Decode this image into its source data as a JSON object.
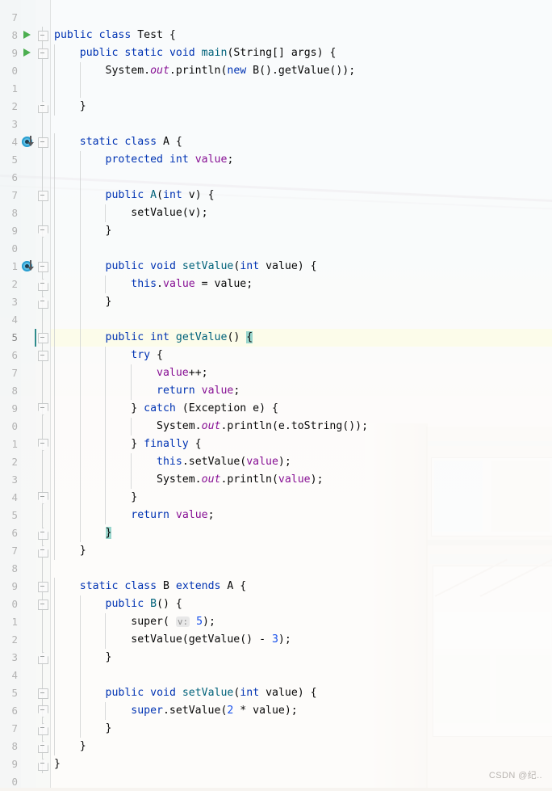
{
  "editor": {
    "language": "Java",
    "file_name": "Test.java",
    "caret_line": 45,
    "theme": "IntelliJ Light",
    "colors": {
      "keyword": "#0033b3",
      "method": "#00627a",
      "field": "#871094",
      "static_field": "#871094",
      "number": "#1750eb",
      "text": "#080808",
      "line_number": "#b3b3b3",
      "caret_line_bg": "#fbfbe0",
      "brace_match_bg": "#99d6cc",
      "run_marker": "#4caf50",
      "override_marker": "#5fc0e8",
      "overriding_arrow": "#e2554f"
    },
    "gutter": {
      "line_numbers": [
        "7",
        "8",
        "9",
        "0",
        "1",
        "2",
        "3",
        "4",
        "5",
        "6",
        "7",
        "8",
        "9",
        "0",
        "1",
        "2",
        "3",
        "4",
        "5",
        "6",
        "7",
        "8",
        "9",
        "0",
        "1",
        "2",
        "3",
        "4",
        "5",
        "6",
        "7",
        "8",
        "9",
        "0",
        "1",
        "2",
        "3",
        "4",
        "5",
        "6",
        "7",
        "8",
        "9",
        "0"
      ],
      "full_line_numbers": [
        7,
        8,
        9,
        10,
        11,
        12,
        13,
        14,
        15,
        16,
        17,
        18,
        19,
        20,
        21,
        22,
        23,
        24,
        25,
        26,
        27,
        28,
        29,
        30,
        31,
        32,
        33,
        34,
        35,
        36,
        37,
        38,
        39,
        40,
        41,
        42,
        43,
        44,
        45,
        46,
        47,
        48,
        49,
        50
      ],
      "markers": [
        {
          "line": 8,
          "type": "run-gutter-icon",
          "label": "Run Test.main()"
        },
        {
          "line": 9,
          "type": "run-gutter-icon",
          "label": "Run main()"
        },
        {
          "line": 14,
          "type": "overridden-method-icon",
          "label": "Method is overridden"
        },
        {
          "line": 21,
          "type": "overridden-method-icon",
          "label": "Method is overridden"
        },
        {
          "line": 55,
          "type": "overriding-method-icon",
          "label": "Overrides method in A"
        }
      ]
    },
    "lines": [
      {
        "n": "7",
        "indent": 0,
        "segments": []
      },
      {
        "n": "8",
        "indent": 0,
        "segments": [
          {
            "t": "public",
            "c": "kw"
          },
          {
            "t": " ",
            "c": ""
          },
          {
            "t": "class",
            "c": "kw"
          },
          {
            "t": " Test {",
            "c": ""
          }
        ]
      },
      {
        "n": "9",
        "indent": 1,
        "segments": [
          {
            "t": "    ",
            "c": ""
          },
          {
            "t": "public",
            "c": "kw"
          },
          {
            "t": " ",
            "c": ""
          },
          {
            "t": "static",
            "c": "kw"
          },
          {
            "t": " ",
            "c": ""
          },
          {
            "t": "void",
            "c": "kw"
          },
          {
            "t": " ",
            "c": ""
          },
          {
            "t": "main",
            "c": "mth"
          },
          {
            "t": "(String[] args) {",
            "c": ""
          }
        ]
      },
      {
        "n": "0",
        "indent": 2,
        "segments": [
          {
            "t": "        System.",
            "c": ""
          },
          {
            "t": "out",
            "c": "stat"
          },
          {
            "t": ".println(",
            "c": ""
          },
          {
            "t": "new",
            "c": "kw"
          },
          {
            "t": " B().getValue());",
            "c": ""
          }
        ]
      },
      {
        "n": "1",
        "indent": 2,
        "segments": []
      },
      {
        "n": "2",
        "indent": 1,
        "segments": [
          {
            "t": "    }",
            "c": ""
          }
        ]
      },
      {
        "n": "3",
        "indent": 0,
        "segments": []
      },
      {
        "n": "4",
        "indent": 1,
        "segments": [
          {
            "t": "    ",
            "c": ""
          },
          {
            "t": "static",
            "c": "kw"
          },
          {
            "t": " ",
            "c": ""
          },
          {
            "t": "class",
            "c": "kw"
          },
          {
            "t": " A {",
            "c": ""
          }
        ]
      },
      {
        "n": "5",
        "indent": 2,
        "segments": [
          {
            "t": "        ",
            "c": ""
          },
          {
            "t": "protected",
            "c": "kw"
          },
          {
            "t": " ",
            "c": ""
          },
          {
            "t": "int",
            "c": "kw"
          },
          {
            "t": " ",
            "c": ""
          },
          {
            "t": "value",
            "c": "fld"
          },
          {
            "t": ";",
            "c": ""
          }
        ]
      },
      {
        "n": "6",
        "indent": 2,
        "segments": []
      },
      {
        "n": "7",
        "indent": 2,
        "segments": [
          {
            "t": "        ",
            "c": ""
          },
          {
            "t": "public",
            "c": "kw"
          },
          {
            "t": " ",
            "c": ""
          },
          {
            "t": "A",
            "c": "mth"
          },
          {
            "t": "(",
            "c": ""
          },
          {
            "t": "int",
            "c": "kw"
          },
          {
            "t": " v) {",
            "c": ""
          }
        ]
      },
      {
        "n": "8",
        "indent": 3,
        "segments": [
          {
            "t": "            setValue(v);",
            "c": ""
          }
        ]
      },
      {
        "n": "9",
        "indent": 2,
        "segments": [
          {
            "t": "        }",
            "c": ""
          }
        ]
      },
      {
        "n": "0",
        "indent": 2,
        "segments": []
      },
      {
        "n": "1",
        "indent": 2,
        "segments": [
          {
            "t": "        ",
            "c": ""
          },
          {
            "t": "public",
            "c": "kw"
          },
          {
            "t": " ",
            "c": ""
          },
          {
            "t": "void",
            "c": "kw"
          },
          {
            "t": " ",
            "c": ""
          },
          {
            "t": "setValue",
            "c": "mth"
          },
          {
            "t": "(",
            "c": ""
          },
          {
            "t": "int",
            "c": "kw"
          },
          {
            "t": " value) {",
            "c": ""
          }
        ]
      },
      {
        "n": "2",
        "indent": 3,
        "segments": [
          {
            "t": "            ",
            "c": ""
          },
          {
            "t": "this",
            "c": "kw"
          },
          {
            "t": ".",
            "c": ""
          },
          {
            "t": "value",
            "c": "fld"
          },
          {
            "t": " = value;",
            "c": ""
          }
        ]
      },
      {
        "n": "3",
        "indent": 2,
        "segments": [
          {
            "t": "        }",
            "c": ""
          }
        ]
      },
      {
        "n": "4",
        "indent": 2,
        "segments": []
      },
      {
        "n": "5",
        "indent": 2,
        "caret": true,
        "segments": [
          {
            "t": "        ",
            "c": ""
          },
          {
            "t": "public",
            "c": "kw"
          },
          {
            "t": " ",
            "c": ""
          },
          {
            "t": "int",
            "c": "kw"
          },
          {
            "t": " ",
            "c": ""
          },
          {
            "t": "getValue",
            "c": "mth"
          },
          {
            "t": "() ",
            "c": ""
          },
          {
            "t": "{",
            "c": "brace-hl"
          }
        ]
      },
      {
        "n": "6",
        "indent": 3,
        "segments": [
          {
            "t": "            ",
            "c": ""
          },
          {
            "t": "try",
            "c": "kw"
          },
          {
            "t": " {",
            "c": ""
          }
        ]
      },
      {
        "n": "7",
        "indent": 4,
        "segments": [
          {
            "t": "                ",
            "c": ""
          },
          {
            "t": "value",
            "c": "fld"
          },
          {
            "t": "++;",
            "c": ""
          }
        ]
      },
      {
        "n": "8",
        "indent": 4,
        "segments": [
          {
            "t": "                ",
            "c": ""
          },
          {
            "t": "return",
            "c": "kw"
          },
          {
            "t": " ",
            "c": ""
          },
          {
            "t": "value",
            "c": "fld"
          },
          {
            "t": ";",
            "c": ""
          }
        ]
      },
      {
        "n": "9",
        "indent": 3,
        "segments": [
          {
            "t": "            } ",
            "c": ""
          },
          {
            "t": "catch",
            "c": "kw"
          },
          {
            "t": " (Exception e) {",
            "c": ""
          }
        ]
      },
      {
        "n": "0",
        "indent": 4,
        "segments": [
          {
            "t": "                System.",
            "c": ""
          },
          {
            "t": "out",
            "c": "stat"
          },
          {
            "t": ".println(e.toString());",
            "c": ""
          }
        ]
      },
      {
        "n": "1",
        "indent": 3,
        "segments": [
          {
            "t": "            } ",
            "c": ""
          },
          {
            "t": "finally",
            "c": "kw"
          },
          {
            "t": " {",
            "c": ""
          }
        ]
      },
      {
        "n": "2",
        "indent": 4,
        "segments": [
          {
            "t": "                ",
            "c": ""
          },
          {
            "t": "this",
            "c": "kw"
          },
          {
            "t": ".setValue(",
            "c": ""
          },
          {
            "t": "value",
            "c": "fld"
          },
          {
            "t": ");",
            "c": ""
          }
        ]
      },
      {
        "n": "3",
        "indent": 4,
        "segments": [
          {
            "t": "                System.",
            "c": ""
          },
          {
            "t": "out",
            "c": "stat"
          },
          {
            "t": ".println(",
            "c": ""
          },
          {
            "t": "value",
            "c": "fld"
          },
          {
            "t": ");",
            "c": ""
          }
        ]
      },
      {
        "n": "4",
        "indent": 3,
        "segments": [
          {
            "t": "            }",
            "c": ""
          }
        ]
      },
      {
        "n": "5",
        "indent": 3,
        "segments": [
          {
            "t": "            ",
            "c": ""
          },
          {
            "t": "return",
            "c": "kw"
          },
          {
            "t": " ",
            "c": ""
          },
          {
            "t": "value",
            "c": "fld"
          },
          {
            "t": ";",
            "c": ""
          }
        ]
      },
      {
        "n": "6",
        "indent": 2,
        "segments": [
          {
            "t": "        ",
            "c": ""
          },
          {
            "t": "}",
            "c": "brace-hl"
          }
        ]
      },
      {
        "n": "7",
        "indent": 1,
        "segments": [
          {
            "t": "    }",
            "c": ""
          }
        ]
      },
      {
        "n": "8",
        "indent": 0,
        "segments": []
      },
      {
        "n": "9",
        "indent": 1,
        "segments": [
          {
            "t": "    ",
            "c": ""
          },
          {
            "t": "static",
            "c": "kw"
          },
          {
            "t": " ",
            "c": ""
          },
          {
            "t": "class",
            "c": "kw"
          },
          {
            "t": " B ",
            "c": ""
          },
          {
            "t": "extends",
            "c": "kw"
          },
          {
            "t": " A {",
            "c": ""
          }
        ]
      },
      {
        "n": "0",
        "indent": 2,
        "segments": [
          {
            "t": "        ",
            "c": ""
          },
          {
            "t": "public",
            "c": "kw"
          },
          {
            "t": " ",
            "c": ""
          },
          {
            "t": "B",
            "c": "mth"
          },
          {
            "t": "() {",
            "c": ""
          }
        ]
      },
      {
        "n": "1",
        "indent": 3,
        "segments": [
          {
            "t": "            super( ",
            "c": ""
          },
          {
            "t": "v:",
            "c": "hint"
          },
          {
            "t": " ",
            "c": ""
          },
          {
            "t": "5",
            "c": "num"
          },
          {
            "t": ");",
            "c": ""
          }
        ]
      },
      {
        "n": "2",
        "indent": 3,
        "segments": [
          {
            "t": "            setValue(getValue() - ",
            "c": ""
          },
          {
            "t": "3",
            "c": "num"
          },
          {
            "t": ");",
            "c": ""
          }
        ]
      },
      {
        "n": "3",
        "indent": 2,
        "segments": [
          {
            "t": "        }",
            "c": ""
          }
        ]
      },
      {
        "n": "4",
        "indent": 2,
        "segments": []
      },
      {
        "n": "5",
        "indent": 2,
        "segments": [
          {
            "t": "        ",
            "c": ""
          },
          {
            "t": "public",
            "c": "kw"
          },
          {
            "t": " ",
            "c": ""
          },
          {
            "t": "void",
            "c": "kw"
          },
          {
            "t": " ",
            "c": ""
          },
          {
            "t": "setValue",
            "c": "mth"
          },
          {
            "t": "(",
            "c": ""
          },
          {
            "t": "int",
            "c": "kw"
          },
          {
            "t": " value) {",
            "c": ""
          }
        ]
      },
      {
        "n": "6",
        "indent": 3,
        "segments": [
          {
            "t": "            ",
            "c": ""
          },
          {
            "t": "super",
            "c": "kw"
          },
          {
            "t": ".setValue(",
            "c": ""
          },
          {
            "t": "2",
            "c": "num"
          },
          {
            "t": " * value);",
            "c": ""
          }
        ]
      },
      {
        "n": "7",
        "indent": 2,
        "segments": [
          {
            "t": "        }",
            "c": ""
          }
        ]
      },
      {
        "n": "8",
        "indent": 1,
        "segments": [
          {
            "t": "    }",
            "c": ""
          }
        ]
      },
      {
        "n": "9",
        "indent": 0,
        "segments": [
          {
            "t": "}",
            "c": ""
          }
        ]
      },
      {
        "n": "0",
        "indent": 0,
        "segments": []
      }
    ]
  },
  "watermark": {
    "text": "CSDN @纪.."
  }
}
